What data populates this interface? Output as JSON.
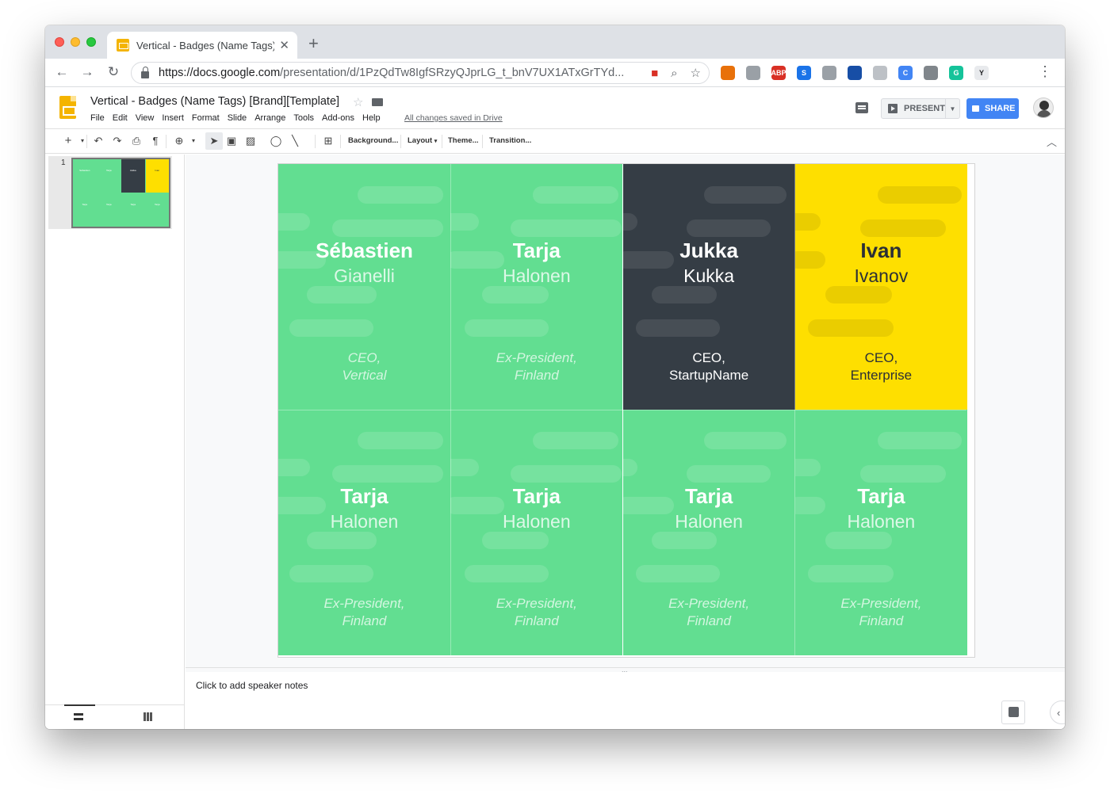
{
  "browser": {
    "tab_title": "Vertical - Badges (Name Tags)",
    "tab_close": "✕",
    "new_tab": "+",
    "url_host": "https://docs.google.com",
    "url_path": "/presentation/d/1PzQdTw8IgfSRzyQJprLG_t_bnV7UX1ATxGrTYd...",
    "extensions": [
      {
        "name": "fire-extension-icon",
        "color": "#e8710a",
        "label": ""
      },
      {
        "name": "drive-extension-icon",
        "color": "#9aa0a6",
        "label": ""
      },
      {
        "name": "adblock-extension-icon",
        "color": "#d93025",
        "label": "ABP"
      },
      {
        "name": "s-extension-icon",
        "color": "#1a73e8",
        "label": "S"
      },
      {
        "name": "circle-extension-icon",
        "color": "#9aa0a6",
        "label": ""
      },
      {
        "name": "chart-extension-icon",
        "color": "#174ea6",
        "label": ""
      },
      {
        "name": "grid-extension-icon",
        "color": "#bdc1c6",
        "label": ""
      },
      {
        "name": "c-extension-icon",
        "color": "#4285f4",
        "label": "C"
      },
      {
        "name": "headset-extension-icon",
        "color": "#80868b",
        "label": ""
      },
      {
        "name": "grammarly-extension-icon",
        "color": "#15c39a",
        "label": "G"
      },
      {
        "name": "y-extension-icon",
        "color": "#e8eaed",
        "label": "Y"
      }
    ]
  },
  "app": {
    "doc_title": "Vertical - Badges (Name Tags) [Brand][Template]",
    "menu": [
      "File",
      "Edit",
      "View",
      "Insert",
      "Format",
      "Slide",
      "Arrange",
      "Tools",
      "Add-ons",
      "Help"
    ],
    "saved_status": "All changes saved in Drive",
    "present_label": "PRESENT",
    "share_label": "SHARE",
    "brand_color": "#f4b400",
    "accent_color": "#4285f4"
  },
  "toolbar": {
    "buttons": [
      "Background...",
      "Layout",
      "Theme...",
      "Transition..."
    ],
    "layout_caret": "▾"
  },
  "filmstrip": {
    "slide_number": "1"
  },
  "badges": [
    {
      "first": "Sébastien",
      "last": "Gianelli",
      "role_line1": "CEO,",
      "role_line2": "Vertical",
      "theme": "green"
    },
    {
      "first": "Tarja",
      "last": "Halonen",
      "role_line1": "Ex-President,",
      "role_line2": "Finland",
      "theme": "green"
    },
    {
      "first": "Jukka",
      "last": "Kukka",
      "role_line1": "CEO,",
      "role_line2": "StartupName",
      "theme": "dark"
    },
    {
      "first": "Ivan",
      "last": "Ivanov",
      "role_line1": "CEO,",
      "role_line2": "Enterprise",
      "theme": "yellow"
    },
    {
      "first": "Tarja",
      "last": "Halonen",
      "role_line1": "Ex-President,",
      "role_line2": "Finland",
      "theme": "green"
    },
    {
      "first": "Tarja",
      "last": "Halonen",
      "role_line1": "Ex-President,",
      "role_line2": "Finland",
      "theme": "green"
    },
    {
      "first": "Tarja",
      "last": "Halonen",
      "role_line1": "Ex-President,",
      "role_line2": "Finland",
      "theme": "green"
    },
    {
      "first": "Tarja",
      "last": "Halonen",
      "role_line1": "Ex-President,",
      "role_line2": "Finland",
      "theme": "green"
    }
  ],
  "badge_colors": {
    "green": "#62de91",
    "dark": "#353d45",
    "yellow": "#fedf00"
  },
  "notes": {
    "placeholder": "Click to add speaker notes",
    "grip": "..."
  }
}
